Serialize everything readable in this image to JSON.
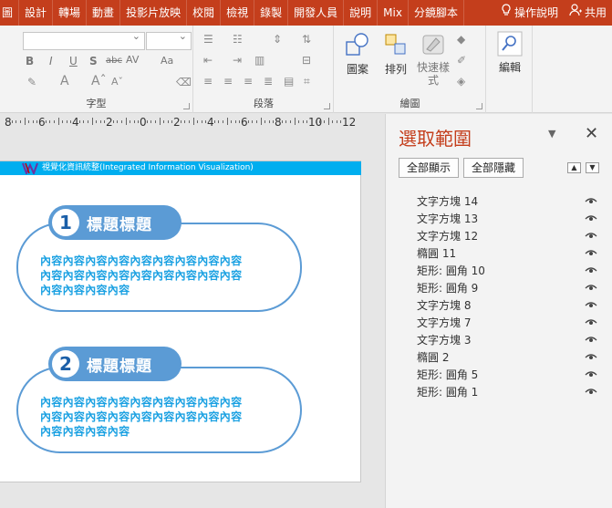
{
  "ribbon_tabs": [
    "圖",
    "設計",
    "轉場",
    "動畫",
    "投影片放映",
    "校閱",
    "檢視",
    "錄製",
    "開發人員",
    "說明",
    "Mix",
    "分鏡腳本"
  ],
  "ribbon_right": {
    "tell_me": "操作說明",
    "share": "共用"
  },
  "ribbon_groups": {
    "font": "字型",
    "paragraph": "段落",
    "drawing": "繪圖"
  },
  "ribbon_buttons": {
    "shapes": "圖案",
    "arrange": "排列",
    "quick_styles": "快速樣式",
    "editing": "編輯"
  },
  "font_controls": [
    "B",
    "I",
    "U",
    "S",
    "abc",
    "AV",
    "Aa"
  ],
  "ruler_numbers": [
    "8",
    "6",
    "4",
    "2",
    "0",
    "2",
    "4",
    "6",
    "8",
    "10",
    "12"
  ],
  "slide": {
    "header": "視覺化資訊統整(Integrated Information Visualization)",
    "items": [
      {
        "num": "1",
        "title": "標題標題",
        "lines": [
          "內容內容內容內容內容內容內容內容內容",
          "內容內容內容內容內容內容內容內容內容",
          "內容內容內容內容"
        ]
      },
      {
        "num": "2",
        "title": "標題標題",
        "lines": [
          "內容內容內容內容內容內容內容內容內容",
          "內容內容內容內容內容內容內容內容內容",
          "內容內容內容內容"
        ]
      }
    ]
  },
  "selection_pane": {
    "title": "選取範圍",
    "show_all": "全部顯示",
    "hide_all": "全部隱藏",
    "objects": [
      "文字方塊 14",
      "文字方塊 13",
      "文字方塊 12",
      "橢圓 11",
      "矩形: 圓角 10",
      "矩形: 圓角 9",
      "文字方塊 8",
      "文字方塊 7",
      "文字方塊 3",
      "橢圓 2",
      "矩形: 圓角 5",
      "矩形: 圓角 1"
    ]
  },
  "colors": {
    "accent": "#c43e1c",
    "slide_header": "#00aeef",
    "pill_border": "#5b9bd5",
    "content_text": "#1ba1e2"
  }
}
